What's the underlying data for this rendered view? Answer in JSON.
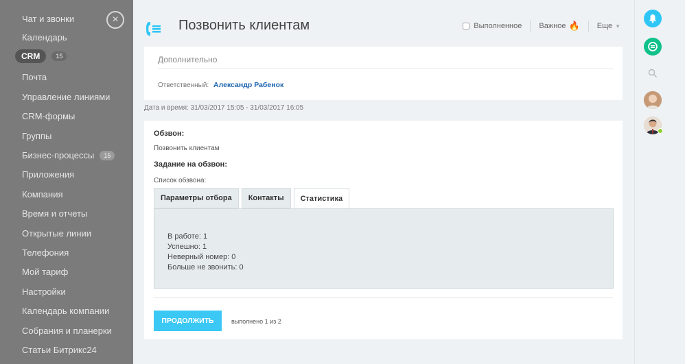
{
  "sidebar": {
    "items": [
      {
        "label": "Чат и звонки"
      },
      {
        "label": "Календарь"
      },
      {
        "label": "CRM",
        "counter": "15"
      },
      {
        "label": "Почта"
      },
      {
        "label": "Управление линиями"
      },
      {
        "label": "CRM-формы"
      },
      {
        "label": "Группы"
      },
      {
        "label": "Бизнес-процессы",
        "counter": "15"
      },
      {
        "label": "Приложения"
      },
      {
        "label": "Компания"
      },
      {
        "label": "Время и отчеты"
      },
      {
        "label": "Открытые линии"
      },
      {
        "label": "Телефония"
      },
      {
        "label": "Мой тариф"
      },
      {
        "label": "Настройки"
      },
      {
        "label": "Календарь компании"
      },
      {
        "label": "Собрания и планерки"
      },
      {
        "label": "Статьи Битрикс24"
      }
    ],
    "close_glyph": "×"
  },
  "header": {
    "title": "Позвонить клиентам",
    "completed_label": "Выполненное",
    "important_label": "Важное",
    "more_label": "Еще"
  },
  "details": {
    "more_label": "Дополнительно",
    "responsible_label": "Ответственный:",
    "responsible_name": "Александр Рабенок",
    "datetime": "Дата и время:  31/03/2017 15:05 - 31/03/2017 16:05"
  },
  "task": {
    "call_label": "Обзвон:",
    "call_value": "Позвонить клиентам",
    "task_label": "Задание на обзвон:",
    "list_label": "Список обзвона:",
    "tabs": [
      "Параметры отбора",
      "Контакты",
      "Статистика"
    ],
    "active_tab": "Статистика",
    "stats": [
      "В работе: 1",
      "Успешно: 1",
      "Неверный номер: 0",
      "Больше не звонить: 0"
    ],
    "continue_label": "продолжить",
    "progress_text": "выполнено 1 из 2"
  },
  "colors": {
    "accent": "#3bc8f5",
    "link": "#2067b0",
    "bell": "#2fc6f6",
    "chat": "#11c18c"
  },
  "icons": {
    "phone": "phone-list-icon",
    "bell": "bell-icon",
    "chat": "chat-icon",
    "search": "search-icon"
  }
}
